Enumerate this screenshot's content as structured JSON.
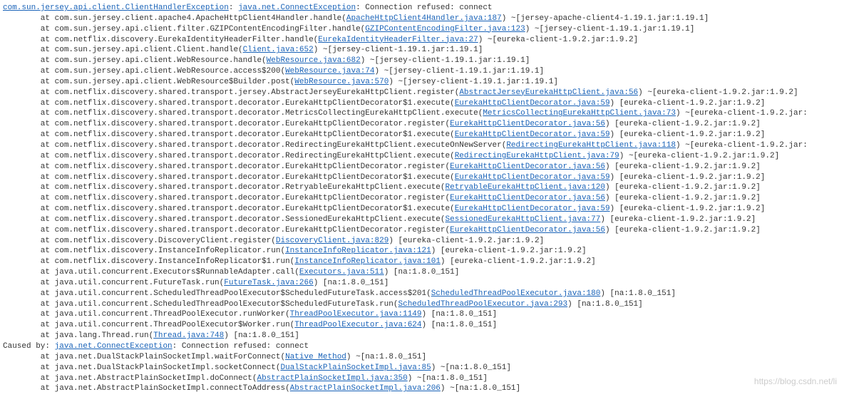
{
  "header": {
    "link1": "com.sun.jersey.api.client.ClientHandlerException",
    "sep1": ": ",
    "link2": "java.net.ConnectException",
    "tail": ": Connection refused: connect"
  },
  "frames": [
    {
      "pre": "        at com.sun.jersey.client.apache4.ApacheHttpClient4Handler.handle(",
      "link": "ApacheHttpClient4Handler.java:187",
      "post": ") ~[jersey-apache-client4-1.19.1.jar:1.19.1]"
    },
    {
      "pre": "        at com.sun.jersey.api.client.filter.GZIPContentEncodingFilter.handle(",
      "link": "GZIPContentEncodingFilter.java:123",
      "post": ") ~[jersey-client-1.19.1.jar:1.19.1]"
    },
    {
      "pre": "        at com.netflix.discovery.EurekaIdentityHeaderFilter.handle(",
      "link": "EurekaIdentityHeaderFilter.java:27",
      "post": ") ~[eureka-client-1.9.2.jar:1.9.2]"
    },
    {
      "pre": "        at com.sun.jersey.api.client.Client.handle(",
      "link": "Client.java:652",
      "post": ") ~[jersey-client-1.19.1.jar:1.19.1]"
    },
    {
      "pre": "        at com.sun.jersey.api.client.WebResource.handle(",
      "link": "WebResource.java:682",
      "post": ") ~[jersey-client-1.19.1.jar:1.19.1]"
    },
    {
      "pre": "        at com.sun.jersey.api.client.WebResource.access$200(",
      "link": "WebResource.java:74",
      "post": ") ~[jersey-client-1.19.1.jar:1.19.1]"
    },
    {
      "pre": "        at com.sun.jersey.api.client.WebResource$Builder.post(",
      "link": "WebResource.java:570",
      "post": ") ~[jersey-client-1.19.1.jar:1.19.1]"
    },
    {
      "pre": "        at com.netflix.discovery.shared.transport.jersey.AbstractJerseyEurekaHttpClient.register(",
      "link": "AbstractJerseyEurekaHttpClient.java:56",
      "post": ") ~[eureka-client-1.9.2.jar:1.9.2]"
    },
    {
      "pre": "        at com.netflix.discovery.shared.transport.decorator.EurekaHttpClientDecorator$1.execute(",
      "link": "EurekaHttpClientDecorator.java:59",
      "post": ") [eureka-client-1.9.2.jar:1.9.2]"
    },
    {
      "pre": "        at com.netflix.discovery.shared.transport.decorator.MetricsCollectingEurekaHttpClient.execute(",
      "link": "MetricsCollectingEurekaHttpClient.java:73",
      "post": ") ~[eureka-client-1.9.2.jar:"
    },
    {
      "pre": "        at com.netflix.discovery.shared.transport.decorator.EurekaHttpClientDecorator.register(",
      "link": "EurekaHttpClientDecorator.java:56",
      "post": ") [eureka-client-1.9.2.jar:1.9.2]"
    },
    {
      "pre": "        at com.netflix.discovery.shared.transport.decorator.EurekaHttpClientDecorator$1.execute(",
      "link": "EurekaHttpClientDecorator.java:59",
      "post": ") [eureka-client-1.9.2.jar:1.9.2]"
    },
    {
      "pre": "        at com.netflix.discovery.shared.transport.decorator.RedirectingEurekaHttpClient.executeOnNewServer(",
      "link": "RedirectingEurekaHttpClient.java:118",
      "post": ") ~[eureka-client-1.9.2.jar:"
    },
    {
      "pre": "        at com.netflix.discovery.shared.transport.decorator.RedirectingEurekaHttpClient.execute(",
      "link": "RedirectingEurekaHttpClient.java:79",
      "post": ") ~[eureka-client-1.9.2.jar:1.9.2]"
    },
    {
      "pre": "        at com.netflix.discovery.shared.transport.decorator.EurekaHttpClientDecorator.register(",
      "link": "EurekaHttpClientDecorator.java:56",
      "post": ") [eureka-client-1.9.2.jar:1.9.2]"
    },
    {
      "pre": "        at com.netflix.discovery.shared.transport.decorator.EurekaHttpClientDecorator$1.execute(",
      "link": "EurekaHttpClientDecorator.java:59",
      "post": ") [eureka-client-1.9.2.jar:1.9.2]"
    },
    {
      "pre": "        at com.netflix.discovery.shared.transport.decorator.RetryableEurekaHttpClient.execute(",
      "link": "RetryableEurekaHttpClient.java:120",
      "post": ") [eureka-client-1.9.2.jar:1.9.2]"
    },
    {
      "pre": "        at com.netflix.discovery.shared.transport.decorator.EurekaHttpClientDecorator.register(",
      "link": "EurekaHttpClientDecorator.java:56",
      "post": ") [eureka-client-1.9.2.jar:1.9.2]"
    },
    {
      "pre": "        at com.netflix.discovery.shared.transport.decorator.EurekaHttpClientDecorator$1.execute(",
      "link": "EurekaHttpClientDecorator.java:59",
      "post": ") [eureka-client-1.9.2.jar:1.9.2]"
    },
    {
      "pre": "        at com.netflix.discovery.shared.transport.decorator.SessionedEurekaHttpClient.execute(",
      "link": "SessionedEurekaHttpClient.java:77",
      "post": ") [eureka-client-1.9.2.jar:1.9.2]"
    },
    {
      "pre": "        at com.netflix.discovery.shared.transport.decorator.EurekaHttpClientDecorator.register(",
      "link": "EurekaHttpClientDecorator.java:56",
      "post": ") [eureka-client-1.9.2.jar:1.9.2]"
    },
    {
      "pre": "        at com.netflix.discovery.DiscoveryClient.register(",
      "link": "DiscoveryClient.java:829",
      "post": ") [eureka-client-1.9.2.jar:1.9.2]"
    },
    {
      "pre": "        at com.netflix.discovery.InstanceInfoReplicator.run(",
      "link": "InstanceInfoReplicator.java:121",
      "post": ") [eureka-client-1.9.2.jar:1.9.2]"
    },
    {
      "pre": "        at com.netflix.discovery.InstanceInfoReplicator$1.run(",
      "link": "InstanceInfoReplicator.java:101",
      "post": ") [eureka-client-1.9.2.jar:1.9.2]"
    },
    {
      "pre": "        at java.util.concurrent.Executors$RunnableAdapter.call(",
      "link": "Executors.java:511",
      "post": ") [na:1.8.0_151]"
    },
    {
      "pre": "        at java.util.concurrent.FutureTask.run(",
      "link": "FutureTask.java:266",
      "post": ") [na:1.8.0_151]"
    },
    {
      "pre": "        at java.util.concurrent.ScheduledThreadPoolExecutor$ScheduledFutureTask.access$201(",
      "link": "ScheduledThreadPoolExecutor.java:180",
      "post": ") [na:1.8.0_151]"
    },
    {
      "pre": "        at java.util.concurrent.ScheduledThreadPoolExecutor$ScheduledFutureTask.run(",
      "link": "ScheduledThreadPoolExecutor.java:293",
      "post": ") [na:1.8.0_151]"
    },
    {
      "pre": "        at java.util.concurrent.ThreadPoolExecutor.runWorker(",
      "link": "ThreadPoolExecutor.java:1149",
      "post": ") [na:1.8.0_151]"
    },
    {
      "pre": "        at java.util.concurrent.ThreadPoolExecutor$Worker.run(",
      "link": "ThreadPoolExecutor.java:624",
      "post": ") [na:1.8.0_151]"
    },
    {
      "pre": "        at java.lang.Thread.run(",
      "link": "Thread.java:748",
      "post": ") [na:1.8.0_151]"
    }
  ],
  "caused": {
    "pre": "Caused by: ",
    "link": "java.net.ConnectException",
    "post": ": Connection refused: connect"
  },
  "cframes": [
    {
      "pre": "        at java.net.DualStackPlainSocketImpl.waitForConnect(",
      "link": "Native Method",
      "post": ") ~[na:1.8.0_151]"
    },
    {
      "pre": "        at java.net.DualStackPlainSocketImpl.socketConnect(",
      "link": "DualStackPlainSocketImpl.java:85",
      "post": ") ~[na:1.8.0_151]"
    },
    {
      "pre": "        at java.net.AbstractPlainSocketImpl.doConnect(",
      "link": "AbstractPlainSocketImpl.java:350",
      "post": ") ~[na:1.8.0_151]"
    },
    {
      "pre": "        at java.net.AbstractPlainSocketImpl.connectToAddress(",
      "link": "AbstractPlainSocketImpl.java:206",
      "post": ") ~[na:1.8.0_151]"
    }
  ],
  "watermark": "https://blog.csdn.net/li"
}
